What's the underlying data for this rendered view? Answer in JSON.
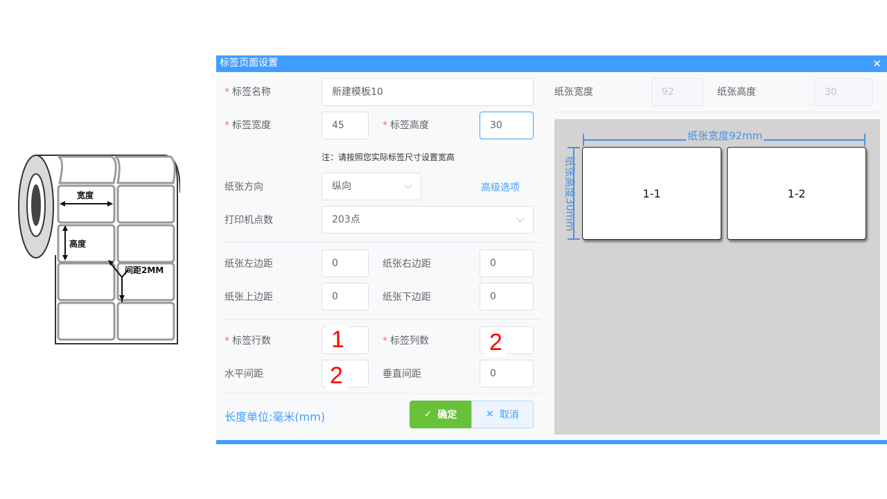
{
  "illustration": {
    "width_label": "宽度",
    "height_label": "高度",
    "gap_label": "间距2MM"
  },
  "dialog": {
    "title": "标签页面设置",
    "close_icon": "close-icon",
    "fields": {
      "label_name": {
        "label": "标签名称",
        "value": "新建模板10"
      },
      "label_width": {
        "label": "标签宽度",
        "value": "45"
      },
      "label_height": {
        "label": "标签高度",
        "value": "30"
      },
      "note": "注：请按照您实际标签尺寸设置宽高",
      "orientation": {
        "label": "纸张方向",
        "value": "纵向"
      },
      "advanced_link": "高级选项",
      "printer_dpi": {
        "label": "打印机点数",
        "value": "203点"
      },
      "margin_left": {
        "label": "纸张左边距",
        "value": "0"
      },
      "margin_right": {
        "label": "纸张右边距",
        "value": "0"
      },
      "margin_top": {
        "label": "纸张上边距",
        "value": "0"
      },
      "margin_bottom": {
        "label": "纸张下边距",
        "value": "0"
      },
      "rows": {
        "label": "标签行数",
        "overlay": "1"
      },
      "cols": {
        "label": "标签列数",
        "overlay": "2"
      },
      "h_gap": {
        "label": "水平间距",
        "overlay": "2"
      },
      "v_gap": {
        "label": "垂直间距",
        "value": "0"
      }
    },
    "unit_label": "长度单位:毫米(mm)",
    "ok_label": "确定",
    "cancel_label": "取消",
    "paper": {
      "width_label": "纸张宽度",
      "width_value": "92",
      "height_label": "纸张高度",
      "height_value": "30"
    },
    "preview": {
      "width_ruler": "纸张宽度92mm",
      "height_ruler": "纸张高度30mm",
      "labels": [
        "1-1",
        "1-2"
      ]
    },
    "colors": {
      "accent": "#409eff",
      "ok": "#67c23a",
      "required": "#f56c6c",
      "annotation": "#ff0000"
    }
  }
}
